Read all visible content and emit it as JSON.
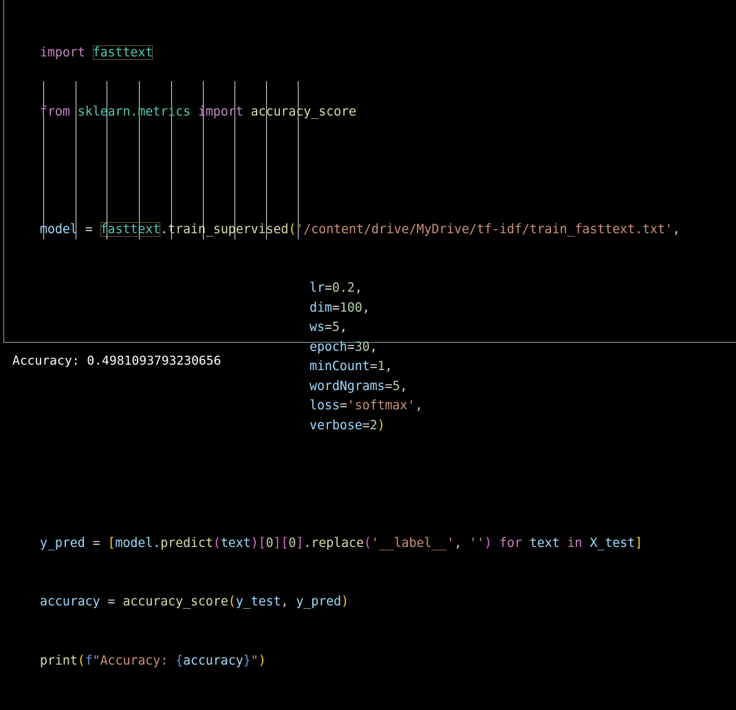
{
  "code": {
    "line1": {
      "kw": "import",
      "mod": "fasttext"
    },
    "line2": {
      "kw_from": "from",
      "mod": "sklearn.metrics",
      "kw_import": "import",
      "name": "accuracy_score"
    },
    "line4": {
      "var": "model",
      "eq": " = ",
      "mod": "fasttext",
      "dot": ".",
      "fn": "train_supervised",
      "open": "(",
      "path": "'/content/drive/MyDrive/tf-idf/train_fasttext.txt'",
      "comma": ","
    },
    "args": [
      {
        "name": "lr",
        "value": "0.2",
        "type": "num"
      },
      {
        "name": "dim",
        "value": "100",
        "type": "num"
      },
      {
        "name": "ws",
        "value": "5",
        "type": "num"
      },
      {
        "name": "epoch",
        "value": "30",
        "type": "num"
      },
      {
        "name": "minCount",
        "value": "1",
        "type": "num"
      },
      {
        "name": "wordNgrams",
        "value": "5",
        "type": "num"
      },
      {
        "name": "loss",
        "value": "'softmax'",
        "type": "str"
      },
      {
        "name": "verbose",
        "value": "2",
        "type": "num"
      }
    ],
    "line14": {
      "var": "y_pred",
      "eq": " = ",
      "ob": "[",
      "model": "model",
      "dot": ".",
      "predict": "predict",
      "po": "(",
      "text": "text",
      "pc": ")",
      "idx1o": "[",
      "zero1": "0",
      "idx1c": "]",
      "idx2o": "[",
      "zero2": "0",
      "idx2c": "]",
      "dot2": ".",
      "replace": "replace",
      "ro": "(",
      "s1": "'__label__'",
      "cm": ", ",
      "s2": "''",
      "rc": ")",
      "for": " for ",
      "text2": "text",
      "in": " in ",
      "xtest": "X_test",
      "cb": "]"
    },
    "line15": {
      "var": "accuracy",
      "eq": " = ",
      "fn": "accuracy_score",
      "o": "(",
      "a1": "y_test",
      "cm": ", ",
      "a2": "y_pred",
      "c": ")"
    },
    "line16": {
      "fn": "print",
      "o": "(",
      "f": "f",
      "s1": "\"Accuracy: ",
      "bo": "{",
      "var": "accuracy",
      "bc": "}",
      "s2": "\"",
      "c": ")"
    }
  },
  "output": {
    "text": "Accuracy: 0.4981093793230656"
  }
}
